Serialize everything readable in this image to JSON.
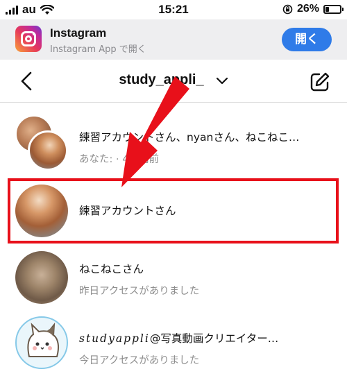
{
  "status_bar": {
    "carrier": "au",
    "time": "15:21",
    "battery": "26%",
    "battery_level": 0.26
  },
  "app_banner": {
    "name": "Instagram",
    "subtitle": "Instagram App で開く",
    "open_button": "開く"
  },
  "header": {
    "title": "study_appli_"
  },
  "threads": [
    {
      "name": "練習アカウントさん、nyanさん、ねこねこ…",
      "subtitle": "あなた: · 4時間前",
      "avatar": "group-avatar"
    },
    {
      "name": "練習アカウントさん",
      "subtitle": "",
      "avatar": "dog-avatar"
    },
    {
      "name": "ねこねこさん",
      "subtitle": "昨日アクセスがありました",
      "avatar": "cat-avatar"
    },
    {
      "name_script": "studyappli",
      "name": "@写真動画クリエイター…",
      "subtitle": "今日アクセスがありました",
      "avatar": "cartoon-cat-avatar"
    }
  ],
  "colors": {
    "accent": "#2f7be8",
    "annotation_red": "#e8101a"
  }
}
